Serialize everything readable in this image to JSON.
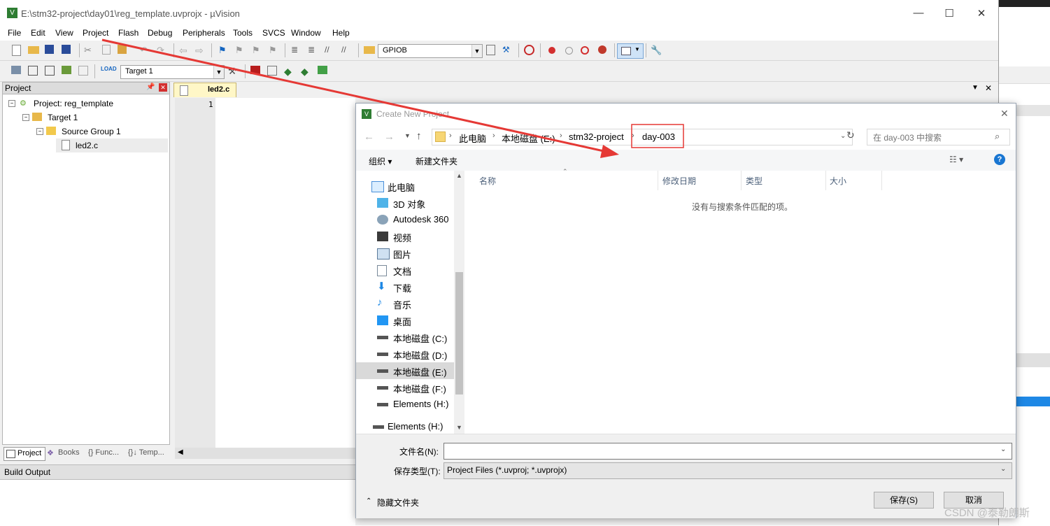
{
  "uv": {
    "title": "E:\\stm32-project\\day01\\reg_template.uvprojx - µVision",
    "menu": [
      "File",
      "Edit",
      "View",
      "Project",
      "Flash",
      "Debug",
      "Peripherals",
      "Tools",
      "SVCS",
      "Window",
      "Help"
    ],
    "toolbar_dropdown": "GPIOB",
    "target_dropdown": "Target 1",
    "window_buttons": {
      "minimize": "—",
      "maximize": "☐",
      "close": "✕"
    },
    "project_panel": {
      "title": "Project",
      "tree": [
        "Project: reg_template",
        "Target 1",
        "Source Group 1",
        "led2.c"
      ],
      "tabs": [
        "Project",
        "Books",
        "{} Func...",
        "{}↓ Temp..."
      ]
    },
    "editor": {
      "tab": "led2.c",
      "line_number": "1"
    },
    "build_output": "Build Output"
  },
  "dialog": {
    "title": "Create New Project",
    "close": "✕",
    "breadcrumb": [
      "此电脑",
      "本地磁盘 (E:)",
      "stm32-project",
      "day-003"
    ],
    "search_placeholder": "在 day-003 中搜索",
    "commands": {
      "organize": "组织 ▾",
      "new_folder": "新建文件夹"
    },
    "nav": [
      "此电脑",
      "3D 对象",
      "Autodesk 360",
      "视频",
      "图片",
      "文档",
      "下载",
      "音乐",
      "桌面",
      "本地磁盘 (C:)",
      "本地磁盘 (D:)",
      "本地磁盘 (E:)",
      "本地磁盘 (F:)",
      "Elements (H:)",
      "Elements (H:)"
    ],
    "selected_nav": "本地磁盘 (E:)",
    "columns": [
      "名称",
      "修改日期",
      "类型",
      "大小"
    ],
    "empty_message": "没有与搜索条件匹配的项。",
    "filename_label": "文件名(N):",
    "filename_value": "",
    "filetype_label": "保存类型(T):",
    "filetype_value": "Project Files (*.uvproj; *.uvprojx)",
    "hide_folders": "隐藏文件夹",
    "save": "保存(S)",
    "cancel": "取消"
  },
  "watermark": "CSDN @泰勒朗斯",
  "colors": {
    "arrow": "#e53935",
    "highlight_box": "#e53935",
    "selected_nav": "#cce8ff"
  }
}
